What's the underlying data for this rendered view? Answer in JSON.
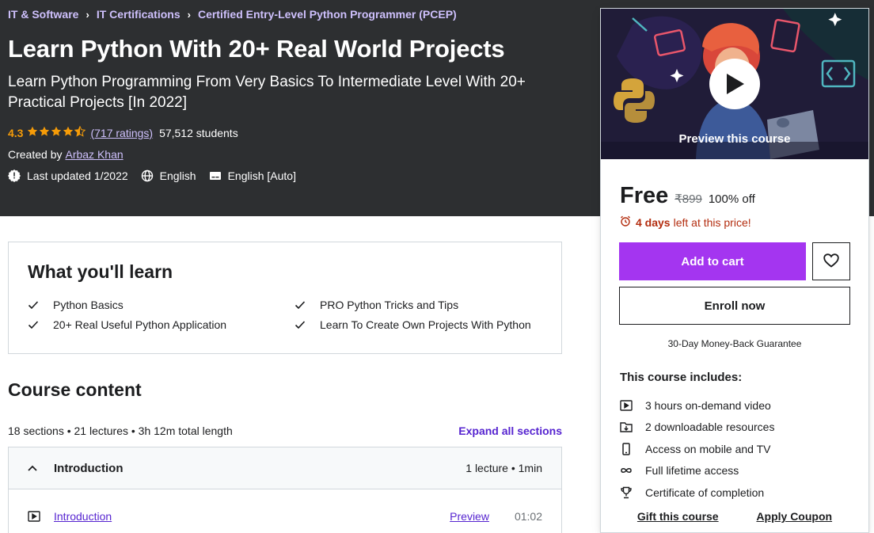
{
  "breadcrumb": [
    {
      "label": "IT & Software"
    },
    {
      "label": "IT Certifications"
    },
    {
      "label": "Certified Entry-Level Python Programmer (PCEP)"
    }
  ],
  "course": {
    "title": "Learn Python With 20+ Real World Projects",
    "subtitle": "Learn Python Programming From Very Basics To Intermediate Level With 20+ Practical Projects [In 2022]",
    "rating": "4.3",
    "rating_value": 4.3,
    "ratings_count": "(717 ratings)",
    "students": "57,512 students",
    "created_label": "Created by",
    "author": "Arbaz Khan",
    "last_updated": "Last updated 1/2022",
    "language": "English",
    "captions": "English [Auto]"
  },
  "sidebar": {
    "preview_label": "Preview this course",
    "price": "Free",
    "original_price": "₹899",
    "discount": "100% off",
    "timer_days": "4 days",
    "timer_text": "left at this price!",
    "add_to_cart": "Add to cart",
    "enroll_now": "Enroll now",
    "guarantee": "30-Day Money-Back Guarantee",
    "includes_title": "This course includes:",
    "includes": [
      {
        "icon": "video-icon",
        "label": "3 hours on-demand video"
      },
      {
        "icon": "download-icon",
        "label": "2 downloadable resources"
      },
      {
        "icon": "mobile-icon",
        "label": "Access on mobile and TV"
      },
      {
        "icon": "infinity-icon",
        "label": "Full lifetime access"
      },
      {
        "icon": "trophy-icon",
        "label": "Certificate of completion"
      }
    ],
    "gift": "Gift this course",
    "coupon": "Apply Coupon"
  },
  "learn": {
    "title": "What you'll learn",
    "items": [
      "Python Basics",
      "PRO Python Tricks and Tips",
      "20+ Real Useful Python Application",
      "Learn To Create Own Projects With Python"
    ]
  },
  "content": {
    "title": "Course content",
    "stats": "18 sections • 21 lectures • 3h 12m total length",
    "expand_all": "Expand all sections",
    "section": {
      "title": "Introduction",
      "meta": "1 lecture • 1min"
    },
    "lecture": {
      "title": "Introduction",
      "preview": "Preview",
      "duration": "01:02"
    }
  },
  "colors": {
    "hero_bg": "#2d2f31",
    "accent_purple": "#a435f0",
    "link_purple": "#5624d0",
    "rating_orange": "#f69c08",
    "timer_red": "#b32d0f"
  }
}
